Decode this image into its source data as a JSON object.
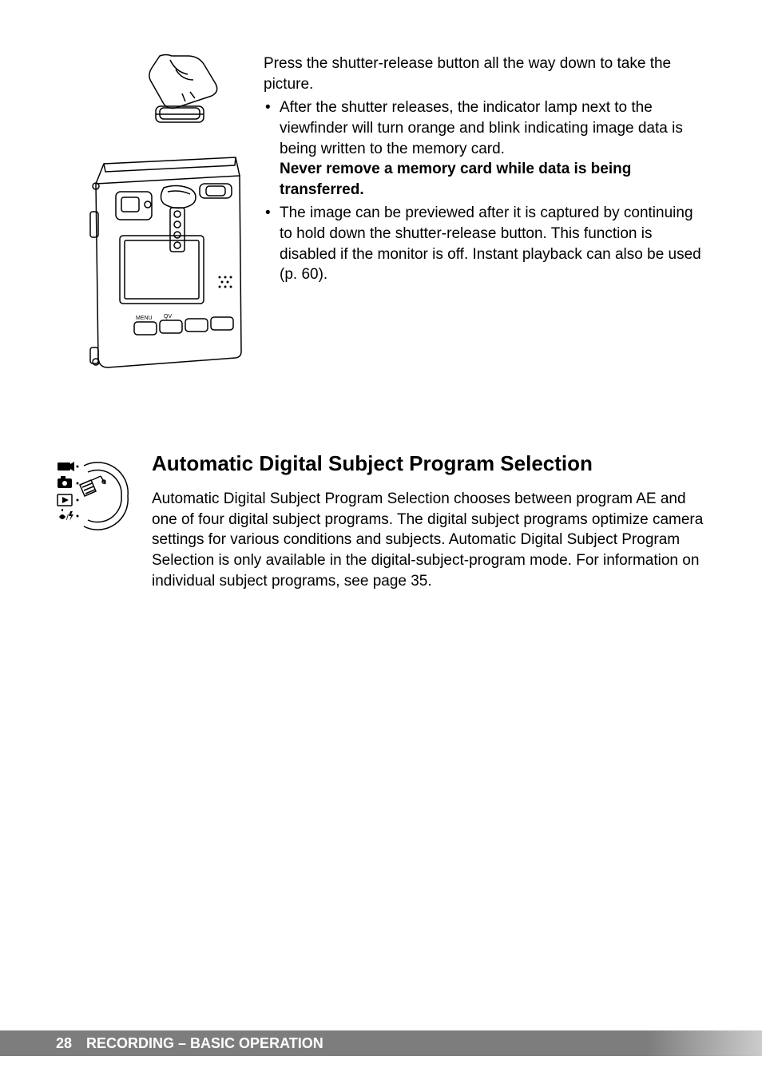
{
  "top_section": {
    "intro": "Press the shutter-release button all the way down to take the picture.",
    "bullets": [
      {
        "text": "After the shutter releases, the indicator lamp next to the viewfinder will turn orange and blink indicating image data is being written to the memory card.",
        "bold_text": "Never remove a memory card while data is being transferred."
      },
      {
        "text": "The image can be previewed after it is captured by continuing to hold down the shutter-release button. This function is disabled if the monitor is off. Instant playback can also be used (p. 60).",
        "bold_text": ""
      }
    ]
  },
  "section": {
    "title": "Automatic Digital Subject Program Selection",
    "body": "Automatic Digital Subject Program Selection chooses between program AE and one of four digital subject programs. The digital subject programs optimize camera settings for various conditions and subjects. Automatic Digital Subject Program Selection is only available in the digital-subject-program mode. For information on individual subject programs, see page 35."
  },
  "footer": {
    "page_number": "28",
    "section_label": "RECORDING – BASIC OPERATION"
  }
}
